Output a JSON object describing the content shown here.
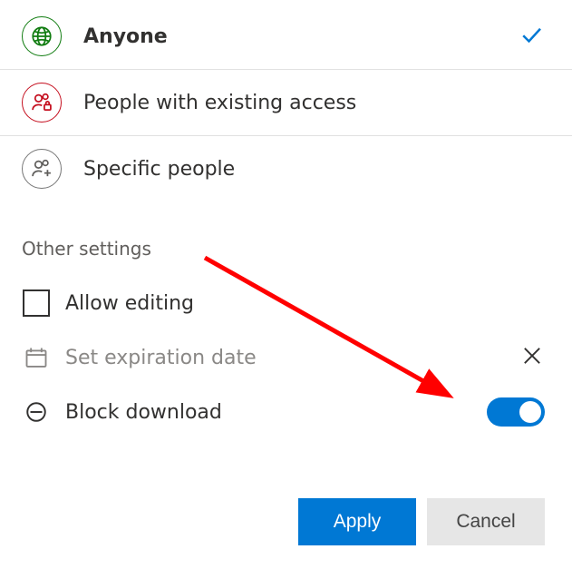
{
  "sharing_options": [
    {
      "label": "Anyone",
      "selected": true,
      "icon": "globe",
      "color": "#107c10"
    },
    {
      "label": "People with existing access",
      "selected": false,
      "icon": "people-lock",
      "color": "#c50f1f"
    },
    {
      "label": "Specific people",
      "selected": false,
      "icon": "people-plus",
      "color": "#605e5c"
    }
  ],
  "other_settings_heading": "Other settings",
  "settings": {
    "allow_editing": {
      "label": "Allow editing",
      "checked": false
    },
    "set_expiration": {
      "label": "Set expiration date"
    },
    "block_download": {
      "label": "Block download",
      "on": true
    }
  },
  "buttons": {
    "apply": "Apply",
    "cancel": "Cancel"
  },
  "annotation": {
    "type": "arrow",
    "color": "#ff0000"
  }
}
